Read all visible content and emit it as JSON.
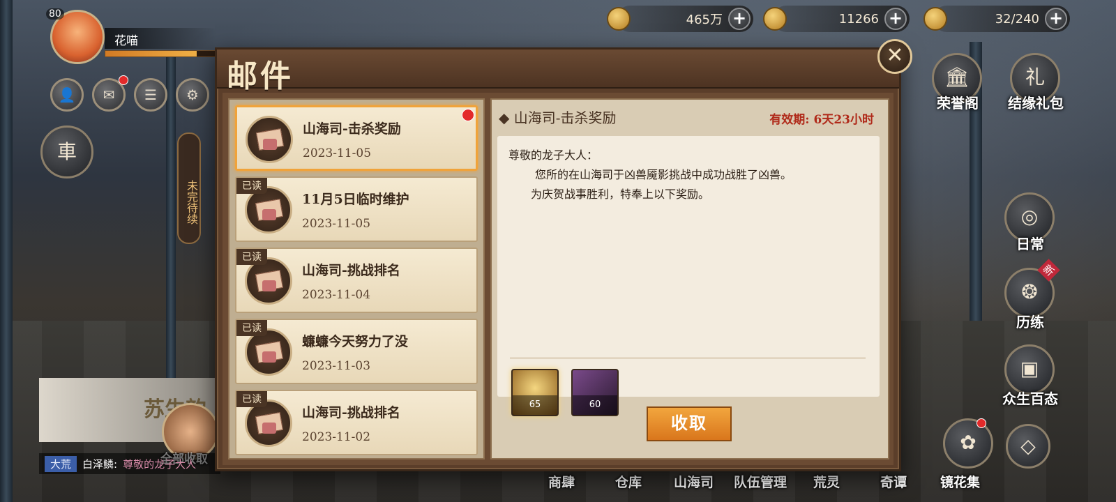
{
  "resources": [
    {
      "icon": "coin-icon",
      "value": "465万"
    },
    {
      "icon": "jade-icon",
      "value": "11266"
    },
    {
      "icon": "stamina-icon",
      "value": "32/240"
    }
  ],
  "player": {
    "level": "80",
    "name": "花喵"
  },
  "left_panel": {
    "car_char": "車",
    "pending_label": "未完待续",
    "banner_text": "苏生韵",
    "claim_all_label": "全部收取"
  },
  "chat": {
    "channel": "大荒",
    "sender": "白泽鳞:",
    "message": "尊敬的龙子大人"
  },
  "right_menu": [
    {
      "label": "荣誉阁"
    },
    {
      "label": "结缘礼包"
    },
    {
      "label": "日常"
    },
    {
      "label": "历练",
      "badge": "新"
    },
    {
      "label": "众生百态"
    },
    {
      "label": "镜花集"
    }
  ],
  "bottom_nav": [
    "商肆",
    "仓库",
    "山海司",
    "队伍管理",
    "荒灵",
    "奇谭",
    "镜花集"
  ],
  "mail": {
    "title": "邮件",
    "items": [
      {
        "subject": "山海司-击杀奖励",
        "date": "2023-11-05",
        "read": false,
        "selected": true
      },
      {
        "subject": "11月5日临时维护",
        "date": "2023-11-05",
        "read": true,
        "read_label": "已读"
      },
      {
        "subject": "山海司-挑战排名",
        "date": "2023-11-04",
        "read": true,
        "read_label": "已读"
      },
      {
        "subject": "蠊蠊今天努力了没",
        "date": "2023-11-03",
        "read": true,
        "read_label": "已读"
      },
      {
        "subject": "山海司-挑战排名",
        "date": "2023-11-02",
        "read": true,
        "read_label": "已读"
      }
    ],
    "detail": {
      "subject": "山海司-击杀奖励",
      "expiry_label": "有效期:",
      "expiry_value": "6天23小时",
      "greeting": "尊敬的龙子大人：",
      "line1": "您所的在山海司于凶兽魇影挑战中成功战胜了凶兽。",
      "line2": "为庆贺战事胜利，特奉上以下奖励。",
      "rewards": [
        {
          "icon": "gold-token-icon",
          "count": "65"
        },
        {
          "icon": "gauntlet-icon",
          "count": "60"
        }
      ],
      "claim_label": "收取"
    }
  }
}
